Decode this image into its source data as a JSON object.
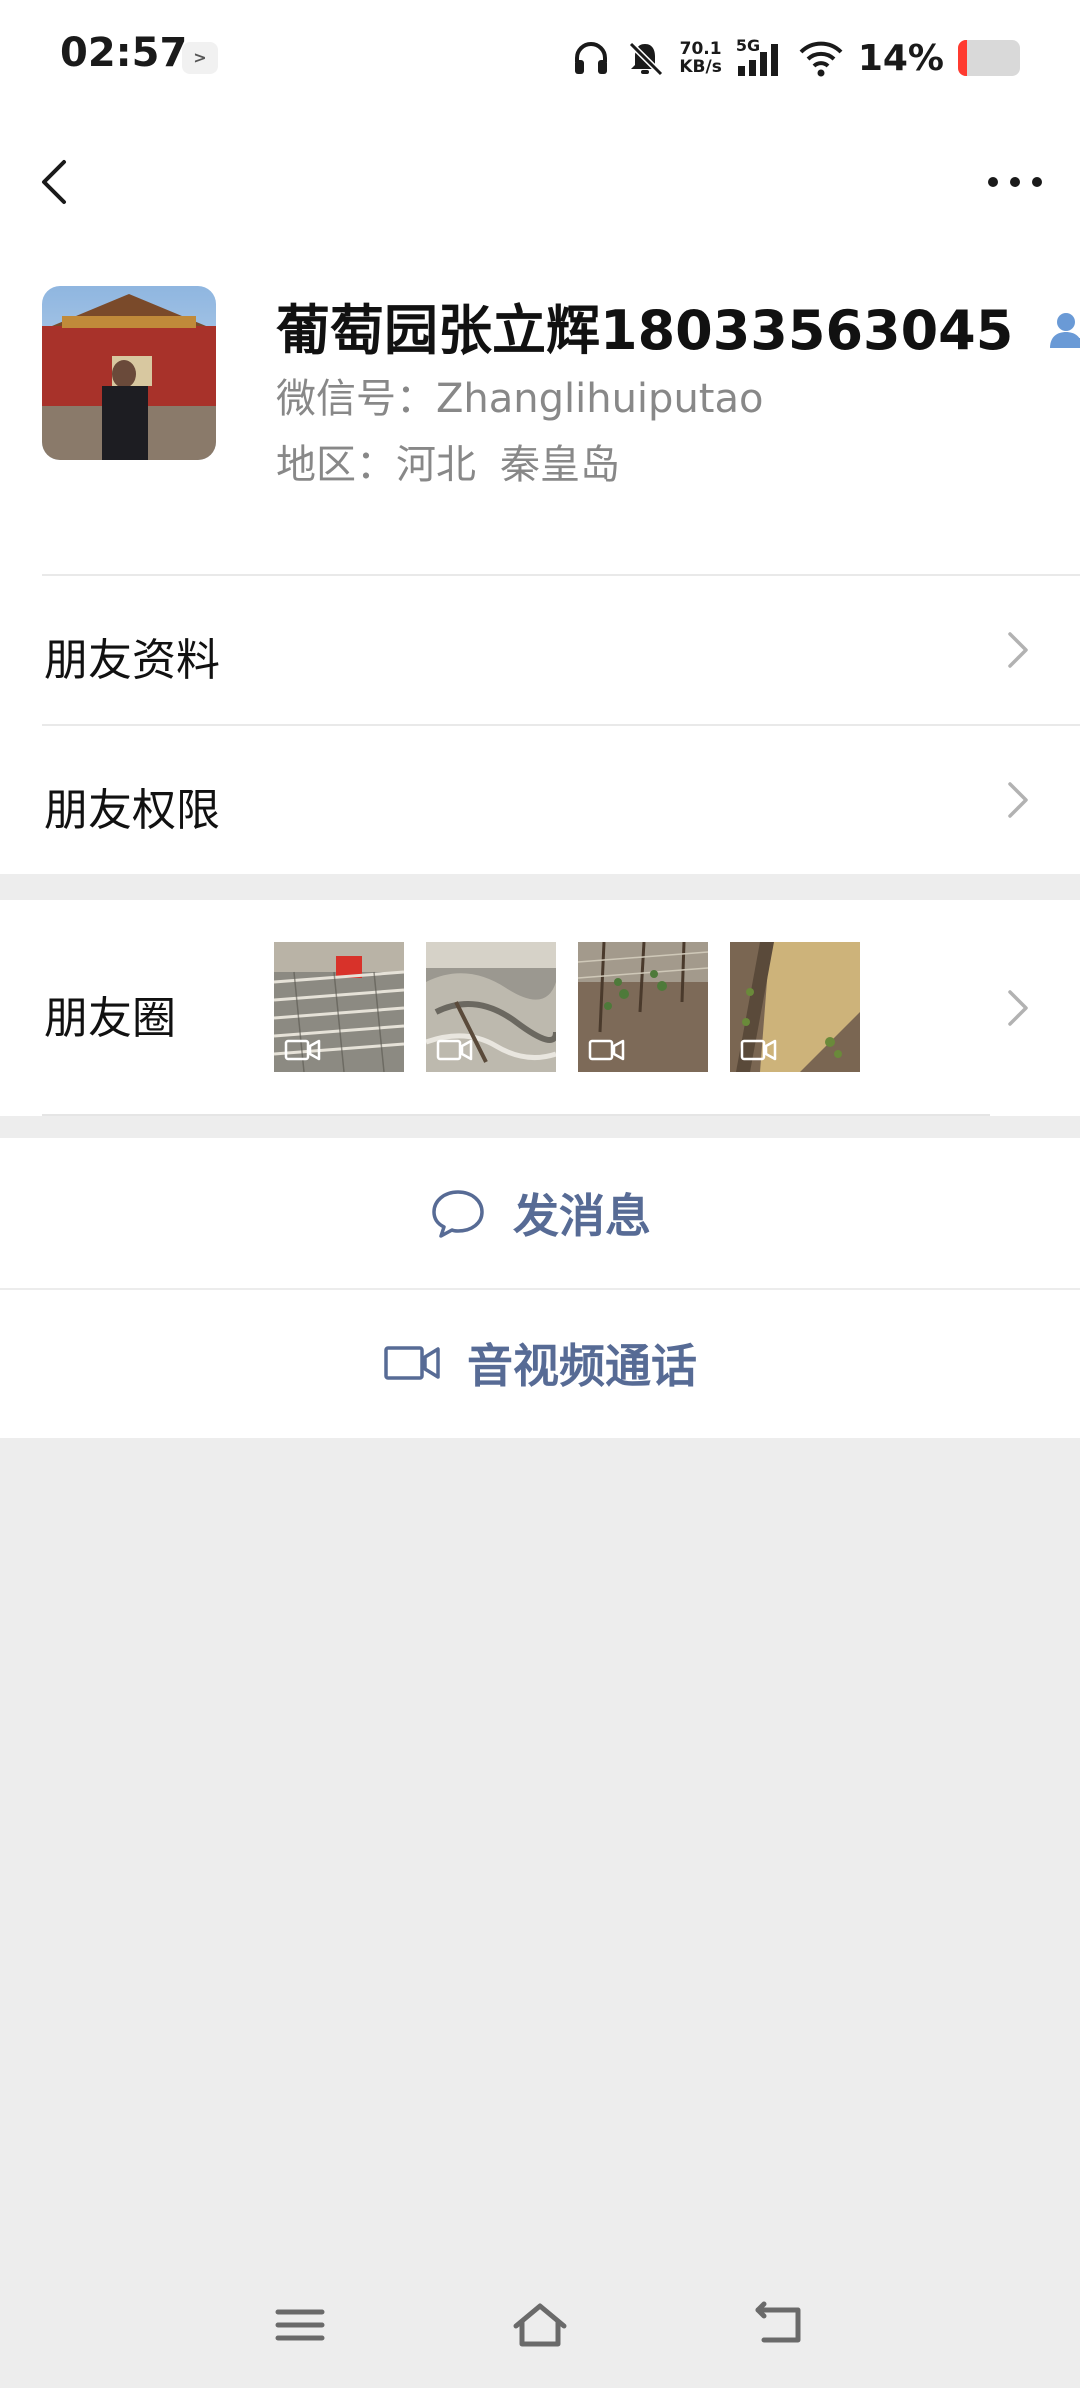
{
  "status_bar": {
    "time": "02:57",
    "app_badge": ">",
    "net_speed_top": "70.1",
    "net_speed_bottom": "KB/s",
    "network": "5G",
    "battery_text": "14%",
    "battery_level": 0.14,
    "icons": [
      "headphones-icon",
      "mute-bell-icon",
      "signal-icon",
      "wifi-icon",
      "battery-icon"
    ]
  },
  "nav": {
    "back_icon": "chevron-left-icon",
    "more_icon": "more-dots-icon"
  },
  "profile": {
    "name": "葡萄园张立辉18033563045",
    "wechat_id": "微信号：Zhanglihuiputao",
    "region_label": "地区：河北",
    "region_city": "秦皇岛",
    "name_icon": "contact-person-icon"
  },
  "rows": {
    "friend_info": "朋友资料",
    "friend_permissions": "朋友权限",
    "moments": "朋友圈"
  },
  "actions": {
    "message": "发消息",
    "video_call": "音视频通话"
  },
  "colors": {
    "link_blue": "#576b95",
    "background": "#ededed",
    "battery_low": "#ff3b30"
  }
}
